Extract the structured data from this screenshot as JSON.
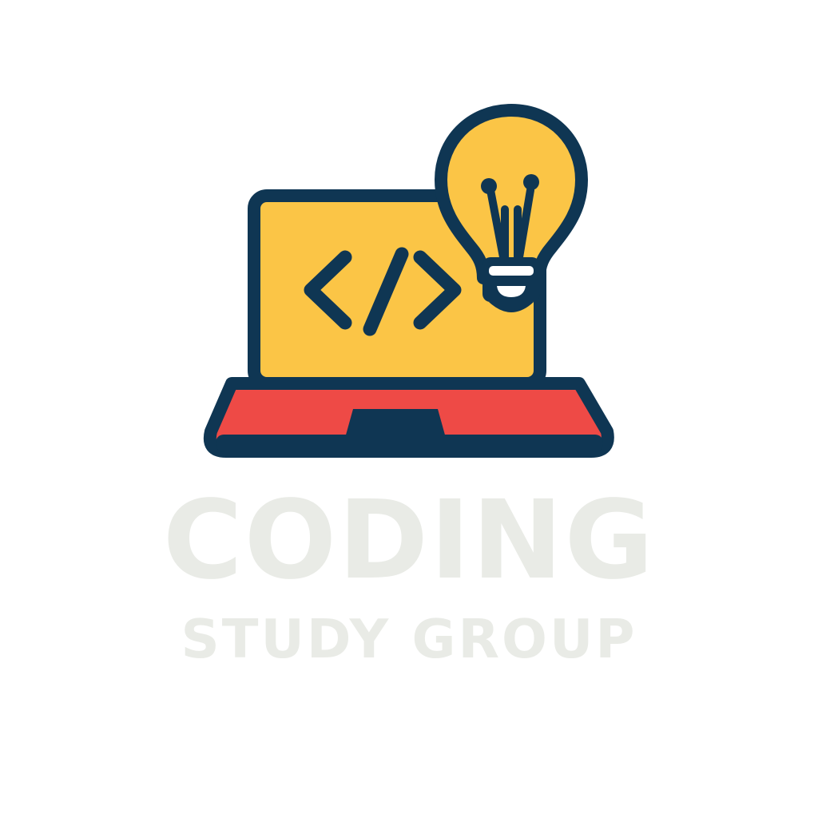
{
  "logo": {
    "icon": "laptop-code-lightbulb-icon",
    "code_symbol": "</>",
    "colors": {
      "outline": "#0f3653",
      "screen": "#fbc546",
      "keyboard": "#ee4a46",
      "bulb_band": "#ffffff"
    }
  },
  "text": {
    "title": "CODING",
    "subtitle": "STUDY GROUP",
    "color": "#e9ebe6"
  }
}
